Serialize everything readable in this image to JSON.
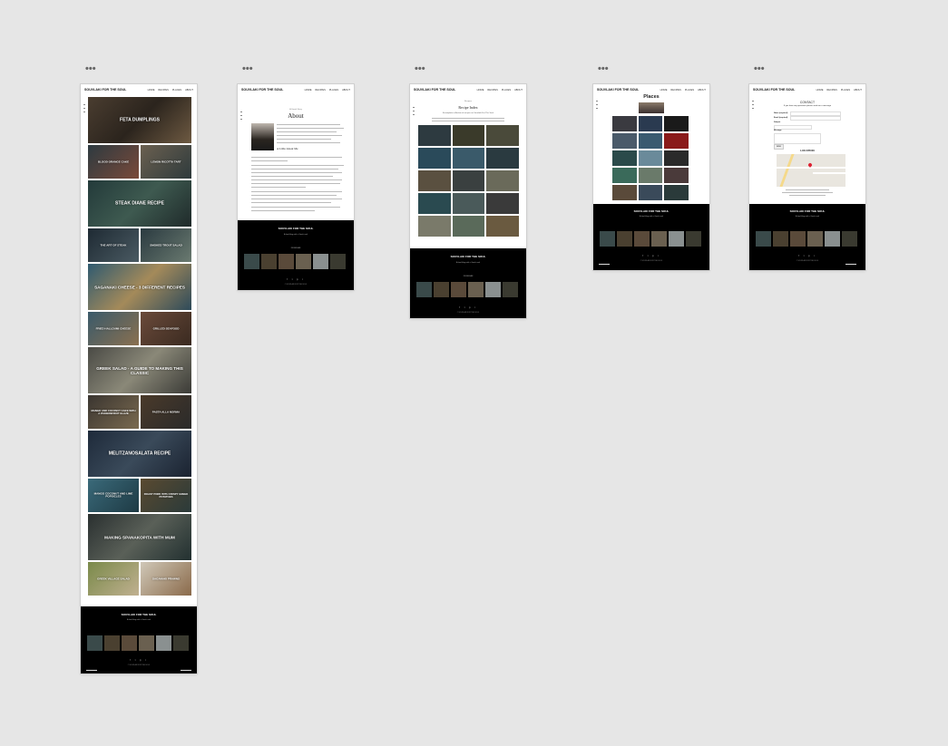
{
  "brand": {
    "logo": "SOUVLAKI FOR THE SOUL"
  },
  "nav": {
    "items": [
      "HOME",
      "RECIPES",
      "PLACES",
      "ABOUT"
    ]
  },
  "boards": {
    "home": {
      "tiles": [
        {
          "title": "FETA DUMPLINGS"
        },
        {
          "title": "BLOOD ORANGE CAKE"
        },
        {
          "title": "LEMON RICOTTA TART"
        },
        {
          "title": "STEAK DIANE RECIPE"
        },
        {
          "title": "THE ART OF STEAK"
        },
        {
          "title": "SMOKED TROUT SALAD"
        },
        {
          "title": "SAGANAKI CHEESE - 3 DIFFERENT RECIPES"
        },
        {
          "title": "FRIED HALLOUMI CHEESE"
        },
        {
          "title": "GRILLED SEAFOOD"
        },
        {
          "title": "GREEK SALAD - A GUIDE TO MAKING THIS CLASSIC"
        },
        {
          "title": "MANGO AND COCONUT CAKE WITH A PASSIONFRUIT GLAZE"
        },
        {
          "title": "PASTA ALLA NORMA"
        },
        {
          "title": "MELITZANOSALATA RECIPE"
        },
        {
          "title": "MANGO COCONUT AND LIME POPSICLES"
        },
        {
          "title": "ROAST PORK WITH CRISPY GREEK POTATOES"
        },
        {
          "title": "MAKING SPANAKOPITA WITH MUM"
        },
        {
          "title": "GREEK VILLAGE SALAD"
        },
        {
          "title": "SAGANAKI PRAWNS"
        }
      ]
    },
    "about": {
      "subtitle": "A Greek Story",
      "title": "About",
      "heading": "A Little About Me"
    },
    "recipes": {
      "kicker": "Recipes",
      "title": "Recipe Index",
      "subtitle": "A complete collection of recipes on Souvlaki For The Soul"
    },
    "places": {
      "title": "Places"
    },
    "contact": {
      "title": "CONTACT",
      "intro": "If you have any questions please send me a message",
      "labels": [
        "Name (required)",
        "Email (required)",
        "Subject",
        "Message"
      ],
      "location": "LOCATION",
      "button": "SEND"
    }
  },
  "footer": {
    "title": "SOUVLAKI FOR THE SOUL",
    "tagline": "A food blog with a Greek soul",
    "instagram": "INSTAGRAM",
    "social": "f t p i",
    "copyright": "© SOUVLAKI FOR THE SOUL"
  },
  "colors": {
    "canvas": "#e6e6e6",
    "footer": "#000000",
    "artboard": "#ffffff"
  }
}
